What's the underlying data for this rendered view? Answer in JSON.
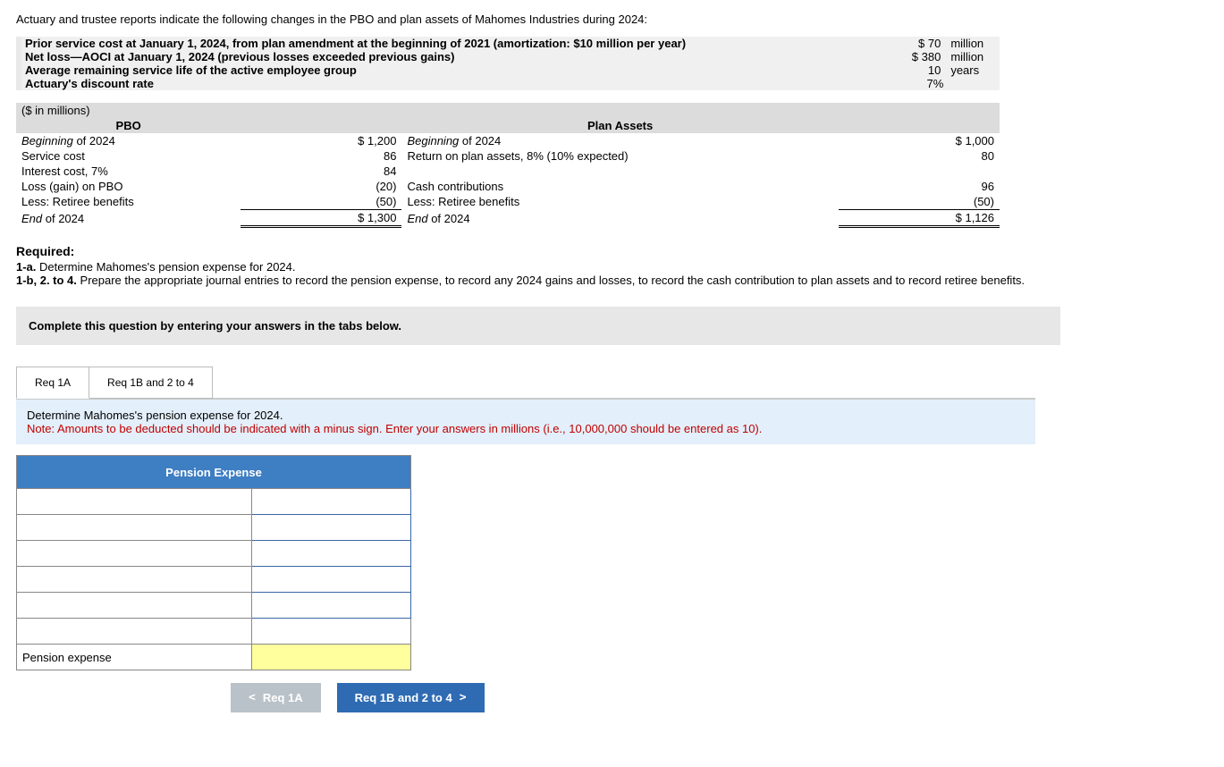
{
  "intro": "Actuary and trustee reports indicate the following changes in the PBO and plan assets of Mahomes Industries during 2024:",
  "assumptions": [
    {
      "label": "Prior service cost at January 1, 2024, from plan amendment at the beginning of 2021 (amortization: $10 million per year)",
      "value": "$ 70",
      "unit": "million"
    },
    {
      "label": "Net loss—AOCI at January 1, 2024 (previous losses exceeded previous gains)",
      "value": "$ 380",
      "unit": "million"
    },
    {
      "label": "Average remaining service life of the active employee group",
      "value": "10",
      "unit": "years"
    },
    {
      "label": "Actuary's discount rate",
      "value": "7%",
      "unit": ""
    }
  ],
  "datatable": {
    "unitsLabel": "($ in millions)",
    "pboHeader": "PBO",
    "assetsHeader": "Plan Assets",
    "pbo": [
      {
        "label": "Beginning of 2024",
        "italic": "Beginning",
        "rest": " of 2024",
        "value": "$ 1,200"
      },
      {
        "label": "Service cost",
        "value": "86"
      },
      {
        "label": "Interest cost, 7%",
        "value": "84"
      },
      {
        "label": "Loss (gain) on PBO",
        "value": "(20)"
      },
      {
        "label": "Less: Retiree benefits",
        "value": "(50)"
      }
    ],
    "pboEnd": {
      "label": "End of 2024",
      "italic": "End",
      "rest": " of 2024",
      "value": "$ 1,300"
    },
    "assets": [
      {
        "label": "Beginning of 2024",
        "italic": "Beginning",
        "rest": " of 2024",
        "value": "$ 1,000"
      },
      {
        "label": "Return on plan assets, 8% (10% expected)",
        "value": "80"
      },
      {
        "label": "",
        "value": ""
      },
      {
        "label": "Cash contributions",
        "value": "96"
      },
      {
        "label": "Less: Retiree benefits",
        "value": "(50)"
      }
    ],
    "assetsEnd": {
      "label": "End of 2024",
      "italic": "End",
      "rest": " of 2024",
      "value": "$ 1,126"
    }
  },
  "required": {
    "heading": "Required:",
    "line1_prefix": "1-a.",
    "line1": " Determine Mahomes's pension expense for 2024.",
    "line2_prefix": "1-b, 2. to 4.",
    "line2": " Prepare the appropriate journal entries to record the pension expense, to record any 2024 gains and losses, to record the cash contribution to plan assets and to record retiree benefits."
  },
  "prompt": "Complete this question by entering your answers in the tabs below.",
  "tabs": {
    "a": "Req 1A",
    "b": "Req 1B and 2 to 4"
  },
  "panel": {
    "title": "Determine Mahomes's pension expense for 2024.",
    "note": "Note: Amounts to be deducted should be indicated with a minus sign. Enter your answers in millions (i.e., 10,000,000 should be entered as 10)."
  },
  "answerTable": {
    "header": "Pension Expense",
    "finalLabel": "Pension expense"
  },
  "nav": {
    "prev": "Req 1A",
    "next": "Req 1B and 2 to 4"
  }
}
